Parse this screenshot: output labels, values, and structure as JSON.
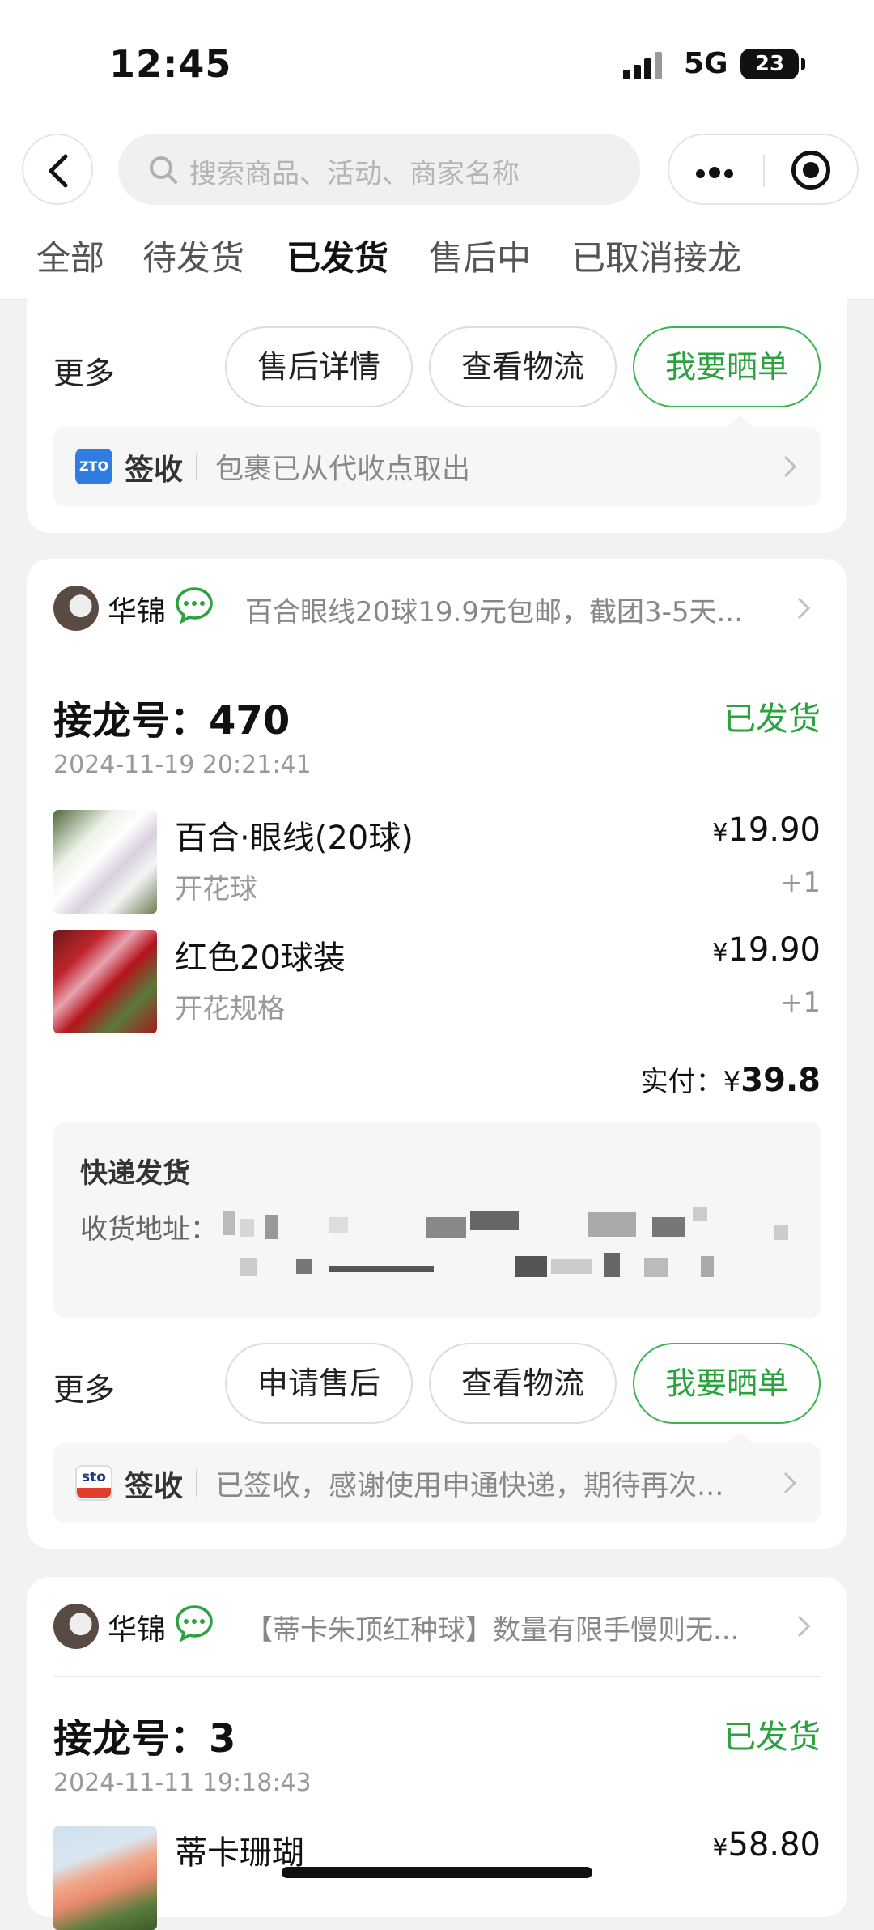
{
  "status_bar": {
    "time": "12:45",
    "network": "5G",
    "battery": "23"
  },
  "header": {
    "search_placeholder": "搜索商品、活动、商家名称",
    "tabs": [
      {
        "label": "全部"
      },
      {
        "label": "待发货"
      },
      {
        "label": "已发货",
        "active": true
      },
      {
        "label": "售后中"
      },
      {
        "label": "已取消接龙"
      }
    ]
  },
  "card1": {
    "more_label": "更多",
    "buttons": [
      "售后详情",
      "查看物流",
      "我要晒单"
    ],
    "tracking": {
      "carrier_logo": "ZTO",
      "title": "签收",
      "text": "包裹已从代收点取出"
    }
  },
  "card2": {
    "shop_name": "华锦",
    "shop_desc": "百合眼线20球19.9元包邮，截团3-5天...",
    "order_label": "接龙号：",
    "order_no": "470",
    "status": "已发货",
    "time": "2024-11-19 20:21:41",
    "items": [
      {
        "name": "百合·眼线(20球)",
        "spec": "开花球",
        "price": "19.90",
        "qty": "+1"
      },
      {
        "name": "红色20球装",
        "spec": "开花规格",
        "price": "19.90",
        "qty": "+1"
      }
    ],
    "yen": "¥",
    "paid_label": "实付：¥",
    "paid_amount": "39.8",
    "shipping": {
      "title": "快递发货",
      "address_label": "收货地址："
    },
    "more_label": "更多",
    "buttons": [
      "申请售后",
      "查看物流",
      "我要晒单"
    ],
    "tracking": {
      "carrier_logo": "sto",
      "title": "签收",
      "text": "已签收，感谢使用申通快递，期待再次..."
    }
  },
  "card3": {
    "shop_name": "华锦",
    "shop_desc": "【蒂卡朱顶红种球】数量有限手慢则无...",
    "order_label": "接龙号：",
    "order_no": "3",
    "status": "已发货",
    "time": "2024-11-11 19:18:43",
    "items": [
      {
        "name": "蒂卡珊瑚",
        "price": "58.80"
      }
    ],
    "yen": "¥"
  },
  "colors": {
    "accent_green": "#2aa23e",
    "zto_blue": "#2f7de1",
    "sto_red": "#e33c2a"
  }
}
